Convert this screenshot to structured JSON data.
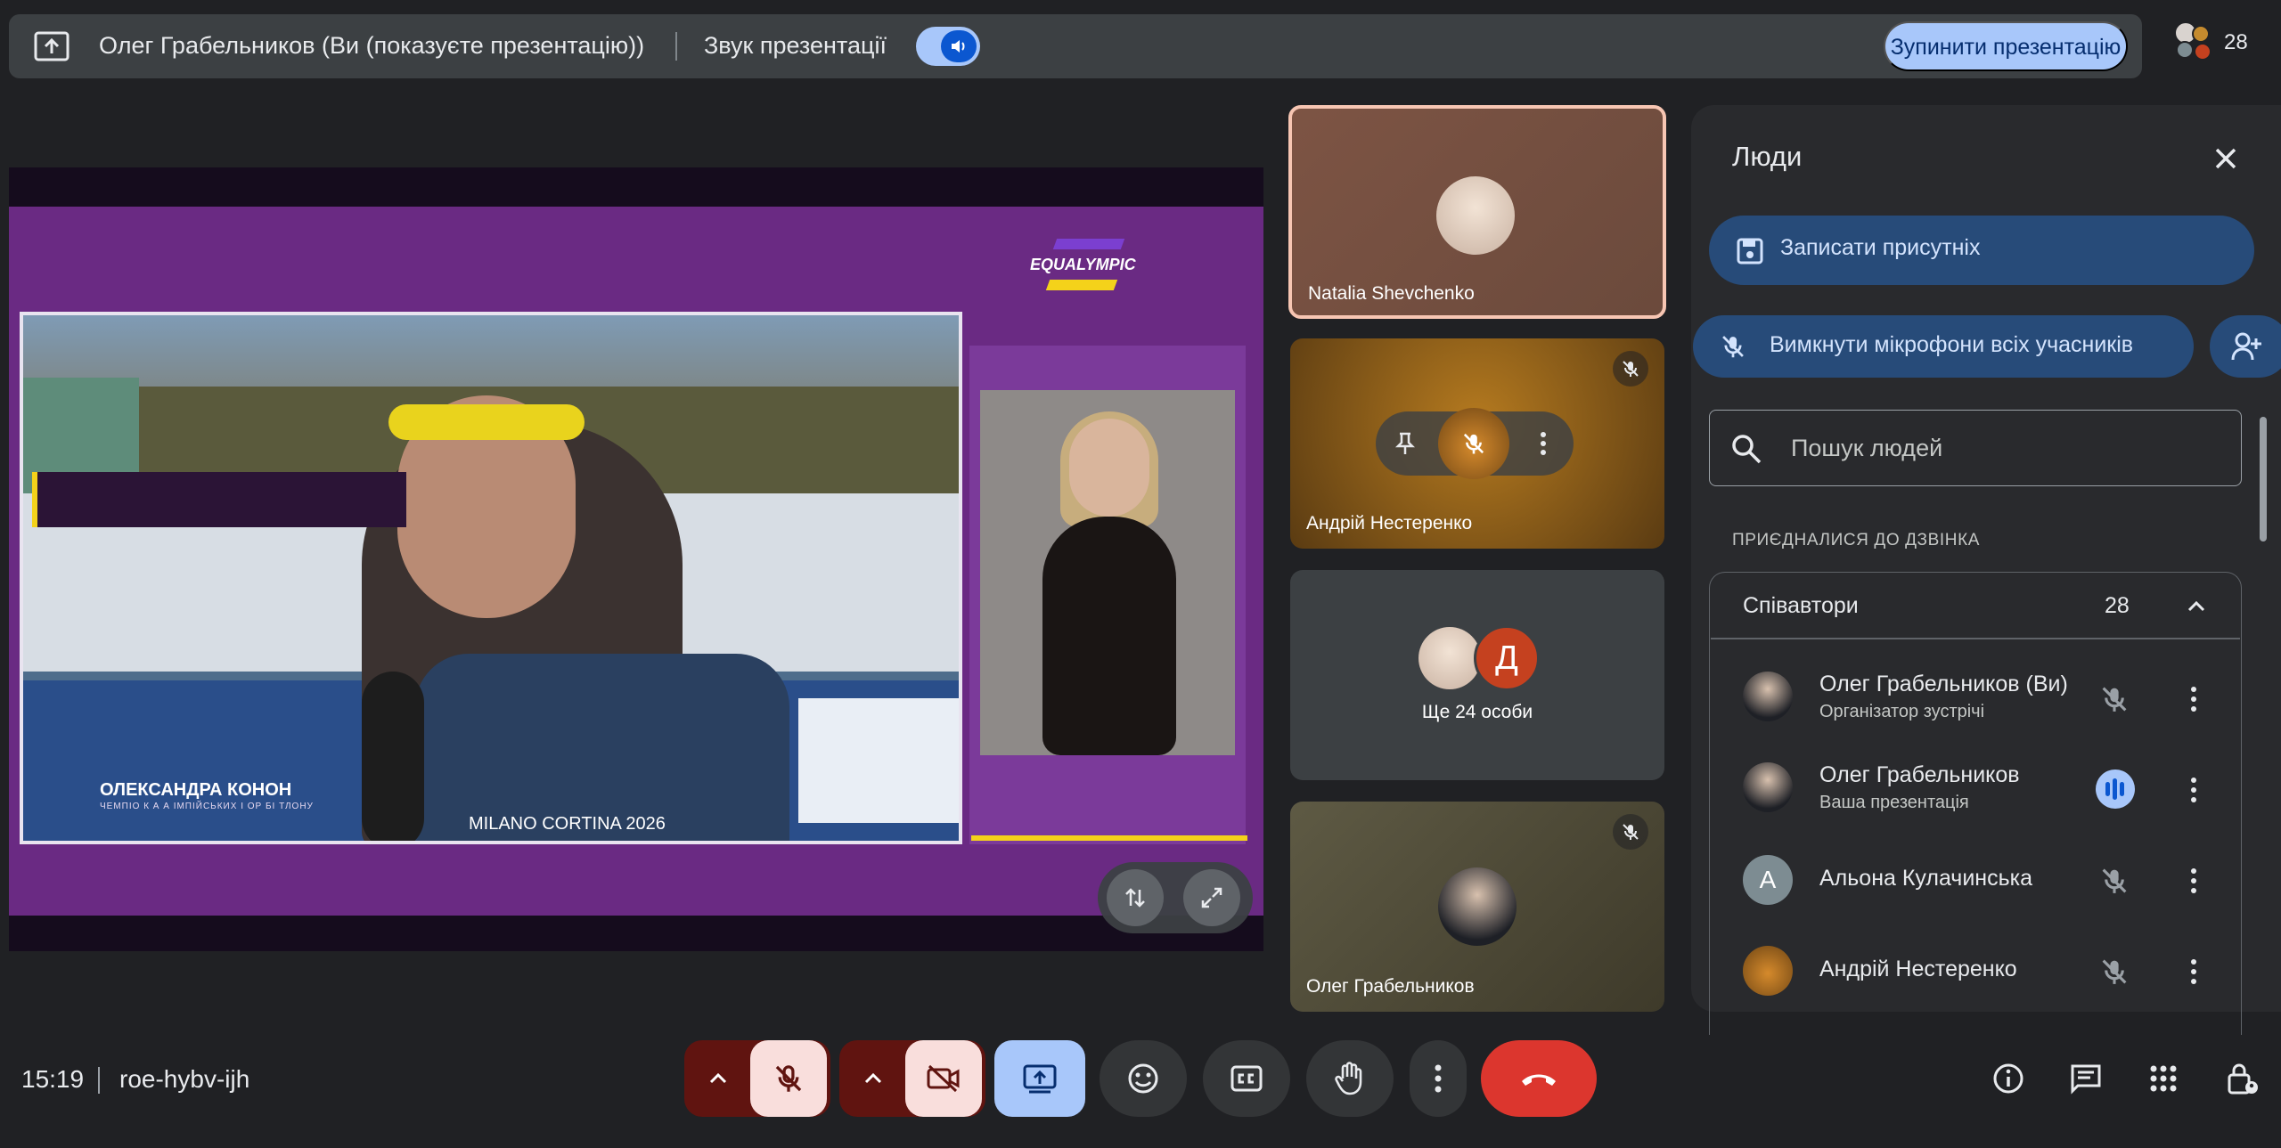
{
  "presenting_bar": {
    "presenter_text": "Олег Грабельников (Ви (показуєте презентацію))",
    "audio_label": "Звук презентації",
    "stop_button": "Зупинити презентацію",
    "participant_count": "28"
  },
  "presentation": {
    "logo_text": "EQUALYMPIC",
    "lower_third_name": "ОЛЕКСАНДРА КОНОН",
    "lower_third_title": "ЧЕМПІО К А А ІМПІЙСЬКИХ І ОР БІ ТЛОНУ",
    "bib_text": "MILANO CORTINA 2026"
  },
  "tiles": [
    {
      "name": "Natalia Shevchenko"
    },
    {
      "name": "Андрій Нестеренко"
    },
    {
      "name": "Ще 24 особи",
      "initial": "Д"
    },
    {
      "name": "Олег Грабельников"
    }
  ],
  "people_panel": {
    "title": "Люди",
    "record_button": "Записати присутніх",
    "mute_all_button": "Вимкнути мікрофони всіх учасників",
    "search_placeholder": "Пошук людей",
    "section_label": "ПРИЄДНАЛИСЯ ДО ДЗВІНКА",
    "group_name": "Співавтори",
    "group_count": "28",
    "participants": [
      {
        "name": "Олег Грабельников (Ви)",
        "subtitle": "Організатор зустрічі"
      },
      {
        "name": "Олег Грабельников",
        "subtitle": "Ваша презентація"
      },
      {
        "name": "Альона Кулачинська",
        "initial": "А"
      },
      {
        "name": "Андрій Нестеренко"
      }
    ]
  },
  "bottom_bar": {
    "time": "15:19",
    "meeting_code": "roe-hybv-ijh"
  },
  "colors": {
    "accent": "#a8c7fa",
    "end_call": "#dc362e",
    "muted_bg": "#f9dedc",
    "panel_bg": "#292a2d",
    "slide_purple": "#6a2a83"
  }
}
